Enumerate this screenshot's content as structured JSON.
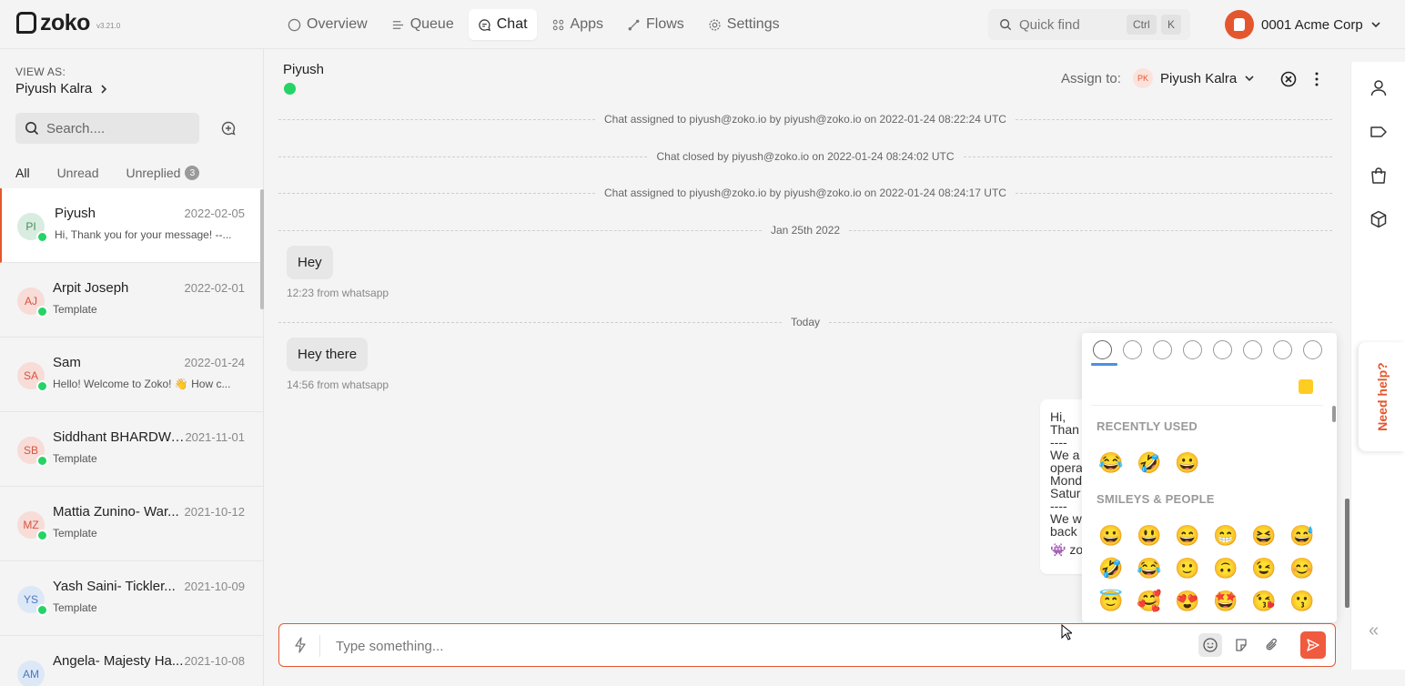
{
  "app": {
    "name": "zoko",
    "version": "v3.21.0"
  },
  "nav": [
    {
      "label": "Overview",
      "icon": "circle-icon",
      "active": false
    },
    {
      "label": "Queue",
      "icon": "queue-icon",
      "active": false
    },
    {
      "label": "Chat",
      "icon": "chat-bubble-icon",
      "active": true
    },
    {
      "label": "Apps",
      "icon": "grid-icon",
      "active": false
    },
    {
      "label": "Flows",
      "icon": "flow-icon",
      "active": false
    },
    {
      "label": "Settings",
      "icon": "gear-icon",
      "active": false
    }
  ],
  "quickfind": {
    "label": "Quick find",
    "key1": "Ctrl",
    "key2": "K"
  },
  "account": {
    "name": "0001 Acme Corp",
    "brand_color": "#e4572e"
  },
  "sidebar": {
    "view_as_label": "VIEW AS:",
    "view_as_name": "Piyush Kalra",
    "search_placeholder": "Search....",
    "filters": {
      "all": "All",
      "unread": "Unread",
      "unreplied": "Unreplied",
      "unreplied_count": "3"
    }
  },
  "chats": [
    {
      "initials": "PI",
      "name": "Piyush",
      "date": "2022-02-05",
      "preview": "Hi, Thank you for your message! --...",
      "avatar_bg": "#d9ece0",
      "avatar_fg": "#4a8a5f"
    },
    {
      "initials": "AJ",
      "name": "Arpit Joseph",
      "date": "2022-02-01",
      "preview": "Template",
      "avatar_bg": "#f7dcd8",
      "avatar_fg": "#d9533f"
    },
    {
      "initials": "SA",
      "name": "Sam",
      "date": "2022-01-24",
      "preview": "Hello! Welcome to Zoko! 👋 How c...",
      "avatar_bg": "#f7dcd8",
      "avatar_fg": "#d9533f"
    },
    {
      "initials": "SB",
      "name": "Siddhant BHARDWA...",
      "date": "2021-11-01",
      "preview": "Template",
      "avatar_bg": "#f7dcd8",
      "avatar_fg": "#d9533f"
    },
    {
      "initials": "MZ",
      "name": "Mattia Zunino- War...",
      "date": "2021-10-12",
      "preview": "Template",
      "avatar_bg": "#f7dcd8",
      "avatar_fg": "#d9533f"
    },
    {
      "initials": "YS",
      "name": "Yash Saini- Tickler...",
      "date": "2021-10-09",
      "preview": "Template",
      "avatar_bg": "#dde8f7",
      "avatar_fg": "#4a78c0"
    },
    {
      "initials": "AM",
      "name": "Angela- Majesty Ha...",
      "date": "2021-10-08",
      "preview": "",
      "avatar_bg": "#dde8f7",
      "avatar_fg": "#4a78c0"
    }
  ],
  "conversation": {
    "contact_name": "Piyush",
    "assign_label": "Assign to:",
    "assignee_initials": "PK",
    "assignee_name": "Piyush Kalra",
    "system_messages": [
      "Chat assigned to piyush@zoko.io by piyush@zoko.io on 2022-01-24 08:22:24 UTC",
      "Chat closed by piyush@zoko.io on 2022-01-24 08:24:02 UTC",
      "Chat assigned to piyush@zoko.io by piyush@zoko.io on 2022-01-24 08:24:17 UTC"
    ],
    "date_dividers": [
      "Jan 25th 2022",
      "Today"
    ],
    "messages": [
      {
        "text": "Hey",
        "meta": "12:23 from whatsapp"
      },
      {
        "text": "Hey there",
        "meta": "14:56 from whatsapp"
      }
    ],
    "outgoing_lines": [
      "Hi,",
      "Than",
      "----",
      "We a",
      "opera",
      "Mond",
      "Satur",
      "----",
      "We w",
      "back",
      "👾 zo"
    ],
    "composer_placeholder": "Type something..."
  },
  "emoji_picker": {
    "tabs": [
      "smileys-tab-icon",
      "food-tab-icon",
      "travel-tab-icon",
      "places-tab-icon",
      "activity-tab-icon",
      "objects-tab-icon",
      "symbols-tab-icon",
      "flags-tab-icon"
    ],
    "recent_label": "RECENTLY USED",
    "recent": [
      "😂",
      "🤣",
      "😀"
    ],
    "smileys_label": "SMILEYS & PEOPLE",
    "smileys": [
      "😀",
      "😃",
      "😄",
      "😁",
      "😆",
      "😅",
      "🤣",
      "😂",
      "🙂",
      "🙃",
      "😉",
      "😊",
      "😇",
      "🥰",
      "😍",
      "🤩",
      "😘",
      "😗"
    ]
  },
  "help": {
    "label": "Need help?"
  }
}
